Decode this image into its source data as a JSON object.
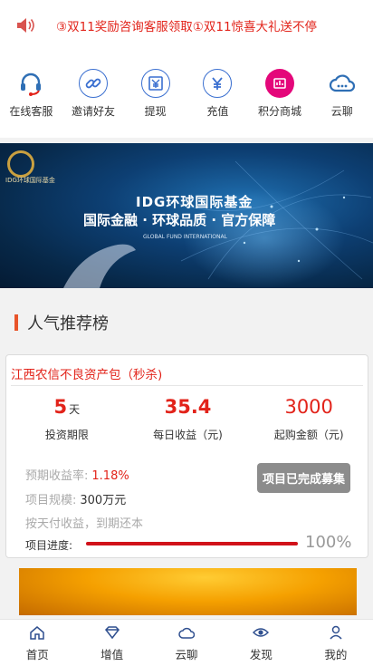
{
  "notice": {
    "icon": "speaker-icon",
    "text": "③双11奖励咨询客服领取①双11惊喜大礼送不停"
  },
  "shortcuts": [
    {
      "label": "在线客服",
      "icon": "headset-icon",
      "color": "#2f6fb5"
    },
    {
      "label": "邀请好友",
      "icon": "link-icon",
      "color": "#3a6fd0"
    },
    {
      "label": "提现",
      "icon": "withdraw-icon",
      "color": "#3a6fd0"
    },
    {
      "label": "充值",
      "icon": "yen-icon",
      "color": "#3a6fd0"
    },
    {
      "label": "积分商城",
      "icon": "points-mall-icon",
      "color": "#e4077a"
    },
    {
      "label": "云聊",
      "icon": "cloud-chat-icon",
      "color": "#2f6fb5"
    }
  ],
  "banner": {
    "logo_text": "IDG环球国际基金",
    "title": "IDG环球国际基金",
    "slogan": "国际金融 · 环球品质 · 官方保障",
    "subtitle": "GLOBAL FUND INTERNATIONAL"
  },
  "section": {
    "title": "人气推荐榜"
  },
  "product": {
    "title": "江西农信不良资产包（秒杀)",
    "stats": [
      {
        "value": "5",
        "unit": "天",
        "label": "投资期限"
      },
      {
        "value": "35.4",
        "unit": "",
        "label": "每日收益（元)"
      },
      {
        "value": "3000",
        "unit": "",
        "label": "起购金额（元)"
      }
    ],
    "rate_label": "预期收益率:",
    "rate_value": "1.18%",
    "scale_label": "项目规模:",
    "scale_value": "300万元",
    "repay_text": "按天付收益，到期还本",
    "status_button": "项目已完成募集",
    "progress_label": "项目进度:",
    "progress_text": "100%",
    "progress_fraction": 1.0
  },
  "tabbar": [
    {
      "label": "首页",
      "icon": "home-icon"
    },
    {
      "label": "增值",
      "icon": "diamond-icon"
    },
    {
      "label": "云聊",
      "icon": "cloud-icon"
    },
    {
      "label": "发现",
      "icon": "eye-icon"
    },
    {
      "label": "我的",
      "icon": "user-icon"
    }
  ],
  "colors": {
    "accent_red": "#e2231a",
    "section_bar": "#e8542a",
    "button_gray": "#8c8c8c"
  }
}
